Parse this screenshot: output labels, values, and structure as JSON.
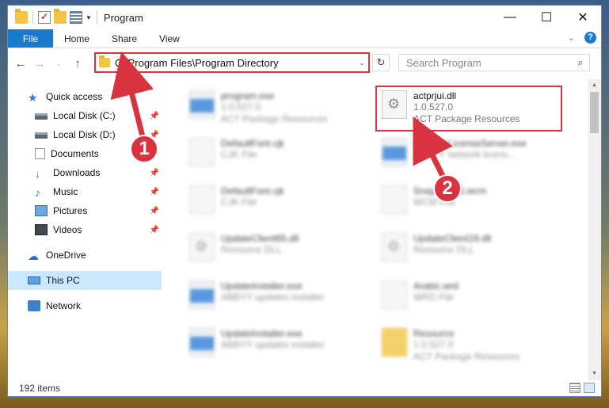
{
  "window": {
    "title": "Program",
    "controls": {
      "minimize": "—",
      "maximize": "☐",
      "close": "✕"
    }
  },
  "ribbon": {
    "tabs": [
      "File",
      "Home",
      "Share",
      "View"
    ]
  },
  "address": {
    "path": "C:\\Program Files\\Program Directory",
    "search_placeholder": "Search Program"
  },
  "sidebar": {
    "quick_access": "Quick access",
    "items": [
      {
        "label": "Local Disk (C:)",
        "icon": "disk-icon",
        "pinned": true
      },
      {
        "label": "Local Disk (D:)",
        "icon": "disk-icon",
        "pinned": true
      },
      {
        "label": "Documents",
        "icon": "documents-icon",
        "pinned": true
      },
      {
        "label": "Downloads",
        "icon": "downloads-icon",
        "pinned": true
      },
      {
        "label": "Music",
        "icon": "music-icon",
        "pinned": true
      },
      {
        "label": "Pictures",
        "icon": "pictures-icon",
        "pinned": true
      },
      {
        "label": "Videos",
        "icon": "videos-icon",
        "pinned": true
      }
    ],
    "onedrive": "OneDrive",
    "this_pc": "This PC",
    "network": "Network"
  },
  "files": [
    {
      "name": "program.exe",
      "line2": "1.0.527.0",
      "line3": "ACT Package Resources",
      "icon": "exe-icon",
      "blurred": true
    },
    {
      "name": "actprjui.dll",
      "line2": "1.0.527.0",
      "line3": "ACT Package Resources",
      "icon": "dll-gear-icon",
      "blurred": false,
      "highlighted": true
    },
    {
      "name": "DefaultFont.cjk",
      "line2": "CJK File",
      "line3": "",
      "icon": "file-icon",
      "blurred": true
    },
    {
      "name": "NetworkLicenseServer.exe",
      "line2": "ABBYY network licens...",
      "line3": "",
      "icon": "exe-icon",
      "blurred": true
    },
    {
      "name": "DefaultFont.cjk",
      "line2": "CJK File",
      "line3": "",
      "icon": "file-icon",
      "blurred": true
    },
    {
      "name": "Snapshot15.wcm",
      "line2": "WCM File",
      "line3": "",
      "icon": "file-icon",
      "blurred": true
    },
    {
      "name": "UpdateClient65.dll",
      "line2": "Resource DLL",
      "line3": "",
      "icon": "dll-gear-icon",
      "blurred": true
    },
    {
      "name": "UpdateClient19.dll",
      "line2": "Resource DLL",
      "line3": "",
      "icon": "dll-gear-icon",
      "blurred": true
    },
    {
      "name": "UpdateInstaller.exe",
      "line2": "ABBYY updates installer",
      "line3": "",
      "icon": "exe-icon",
      "blurred": true
    },
    {
      "name": "Arabic.wrd",
      "line2": "WRD File",
      "line3": "",
      "icon": "file-icon",
      "blurred": true
    },
    {
      "name": "UpdateInstaller.exe",
      "line2": "ABBYY updates installer",
      "line3": "",
      "icon": "exe-icon",
      "blurred": true
    },
    {
      "name": "Resource",
      "line2": "1.0.527.0",
      "line3": "ACT Package Resources",
      "icon": "folder-icon",
      "blurred": true
    }
  ],
  "status": {
    "item_count": "192 items"
  },
  "annotations": {
    "step1": "1",
    "step2": "2",
    "color": "#d9333f"
  }
}
